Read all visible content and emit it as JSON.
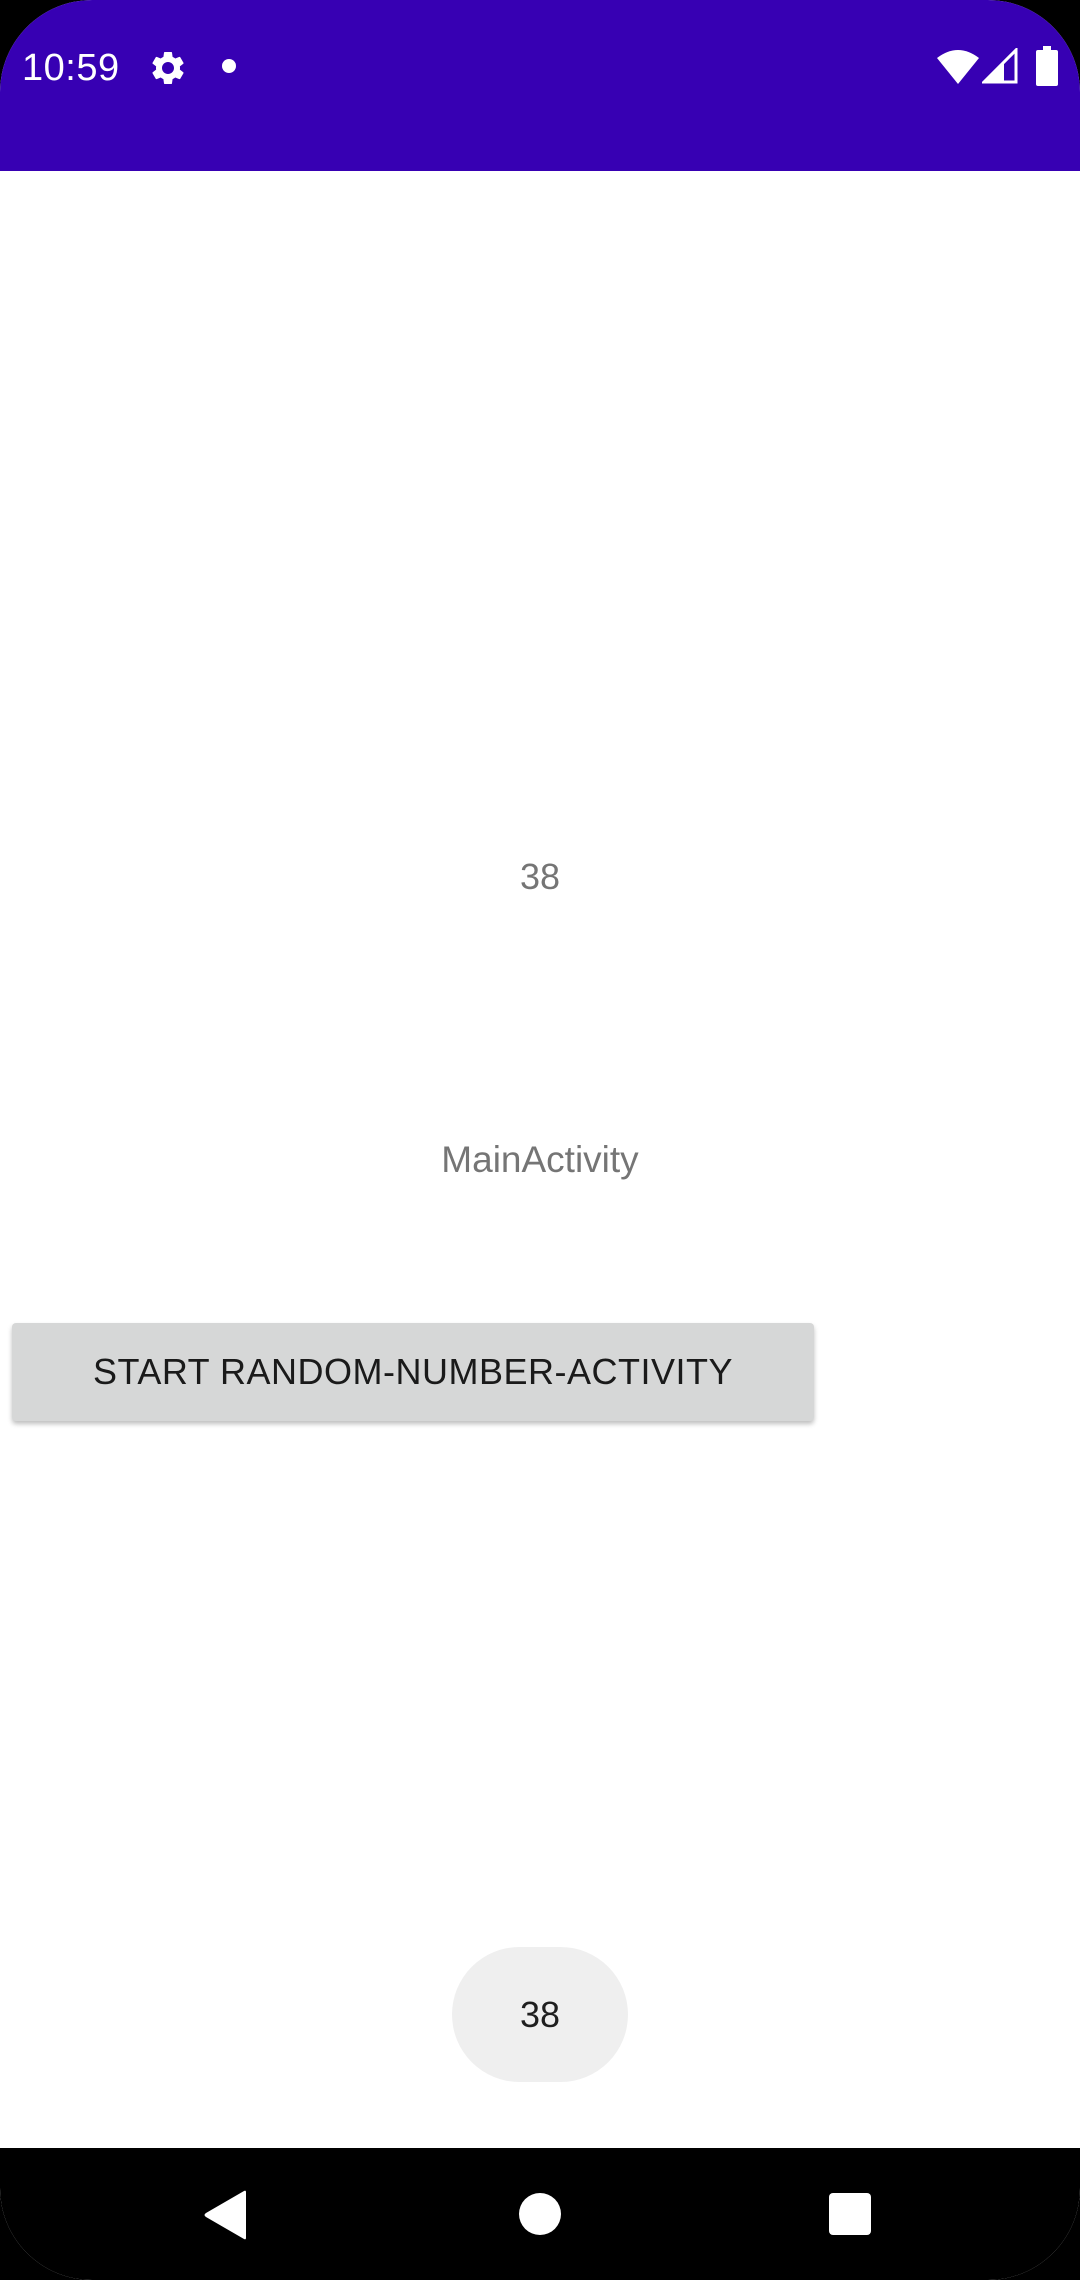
{
  "status_bar": {
    "time": "10:59",
    "background_color": "#3700b3",
    "icons": [
      "settings-gear-icon",
      "notification-dot-icon",
      "wifi-icon",
      "cell-signal-icon",
      "battery-icon"
    ]
  },
  "main": {
    "random_number": "38",
    "activity_label": "MainActivity",
    "start_button_label": "START RANDOM-NUMBER-ACTIVITY"
  },
  "toast": {
    "text": "38"
  },
  "nav_bar": {
    "icons": [
      "back-icon",
      "home-icon",
      "recents-icon"
    ]
  }
}
